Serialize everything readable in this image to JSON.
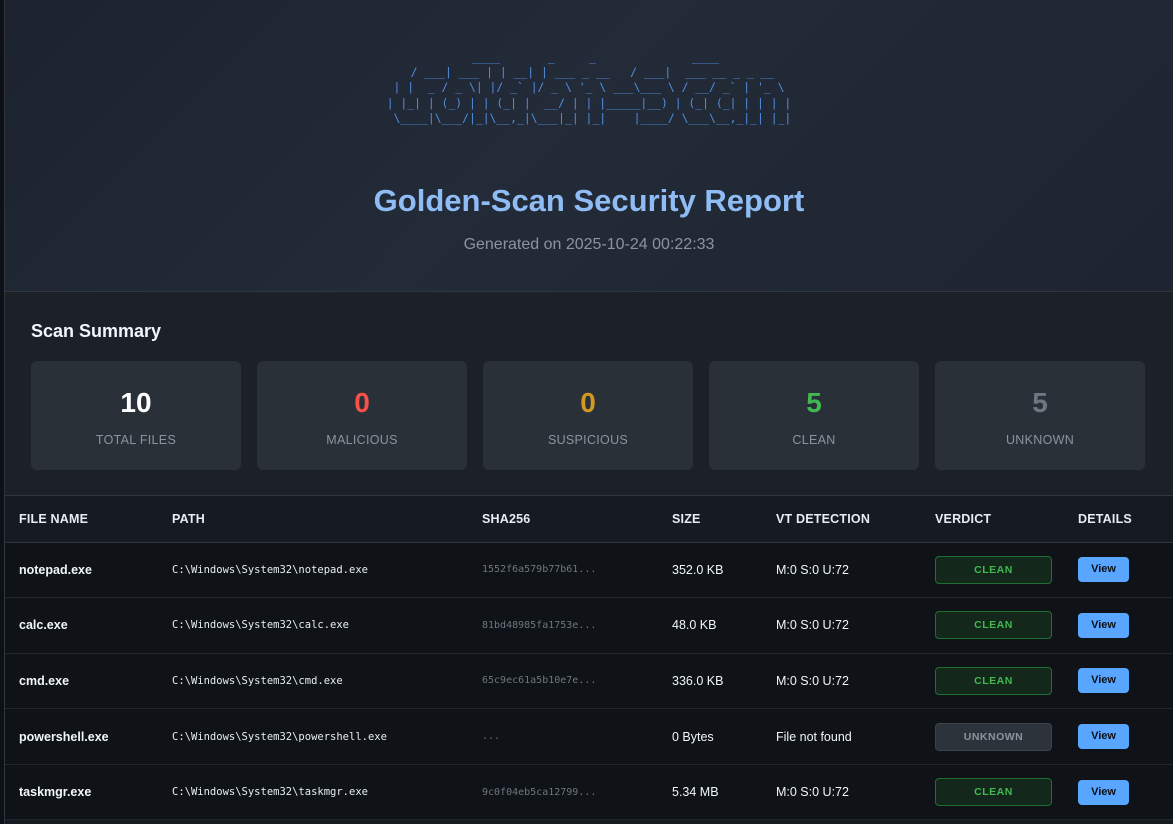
{
  "header": {
    "ascii_art": "  ____       _     _              ____\n / ___| ___ | | __| | ___ _ __   / ___|  ___ __ _ _ __\n| |  _ / _ \\| |/ _` |/ _ \\ '_ \\ ___\\___ \\ / __/ _` | '_ \\\n| |_| | (_) | | (_| |  __/ | | |_____|__) | (_| (_| | | | |\n \\____|\\___/|_|\\__,_|\\___|_| |_|    |____/ \\___\\__,_|_| |_|",
    "title": "Golden-Scan Security Report",
    "generated": "Generated on 2025-10-24 00:22:33"
  },
  "summary": {
    "title": "Scan Summary",
    "cards": [
      {
        "value": "10",
        "label": "TOTAL FILES",
        "color": "#ffffff"
      },
      {
        "value": "0",
        "label": "MALICIOUS",
        "color": "#f85149"
      },
      {
        "value": "0",
        "label": "SUSPICIOUS",
        "color": "#d29922"
      },
      {
        "value": "5",
        "label": "CLEAN",
        "color": "#3fb950"
      },
      {
        "value": "5",
        "label": "UNKNOWN",
        "color": "#6e7681"
      }
    ]
  },
  "table": {
    "headers": [
      "FILE NAME",
      "PATH",
      "SHA256",
      "SIZE",
      "VT DETECTION",
      "VERDICT",
      "DETAILS"
    ],
    "rows": [
      {
        "name": "notepad.exe",
        "path": "C:\\Windows\\System32\\notepad.exe",
        "sha": "1552f6a579b77b61...",
        "size": "352.0 KB",
        "vt": "M:0 S:0 U:72",
        "verdict": "CLEAN",
        "details": "View"
      },
      {
        "name": "calc.exe",
        "path": "C:\\Windows\\System32\\calc.exe",
        "sha": "81bd48985fa1753e...",
        "size": "48.0 KB",
        "vt": "M:0 S:0 U:72",
        "verdict": "CLEAN",
        "details": "View"
      },
      {
        "name": "cmd.exe",
        "path": "C:\\Windows\\System32\\cmd.exe",
        "sha": "65c9ec61a5b10e7e...",
        "size": "336.0 KB",
        "vt": "M:0 S:0 U:72",
        "verdict": "CLEAN",
        "details": "View"
      },
      {
        "name": "powershell.exe",
        "path": "C:\\Windows\\System32\\powershell.exe",
        "sha": "...",
        "size": "0 Bytes",
        "vt": "File not found",
        "verdict": "UNKNOWN",
        "details": "View"
      },
      {
        "name": "taskmgr.exe",
        "path": "C:\\Windows\\System32\\taskmgr.exe",
        "sha": "9c0f04eb5ca12799...",
        "size": "5.34 MB",
        "vt": "M:0 S:0 U:72",
        "verdict": "CLEAN",
        "details": "View"
      }
    ]
  }
}
